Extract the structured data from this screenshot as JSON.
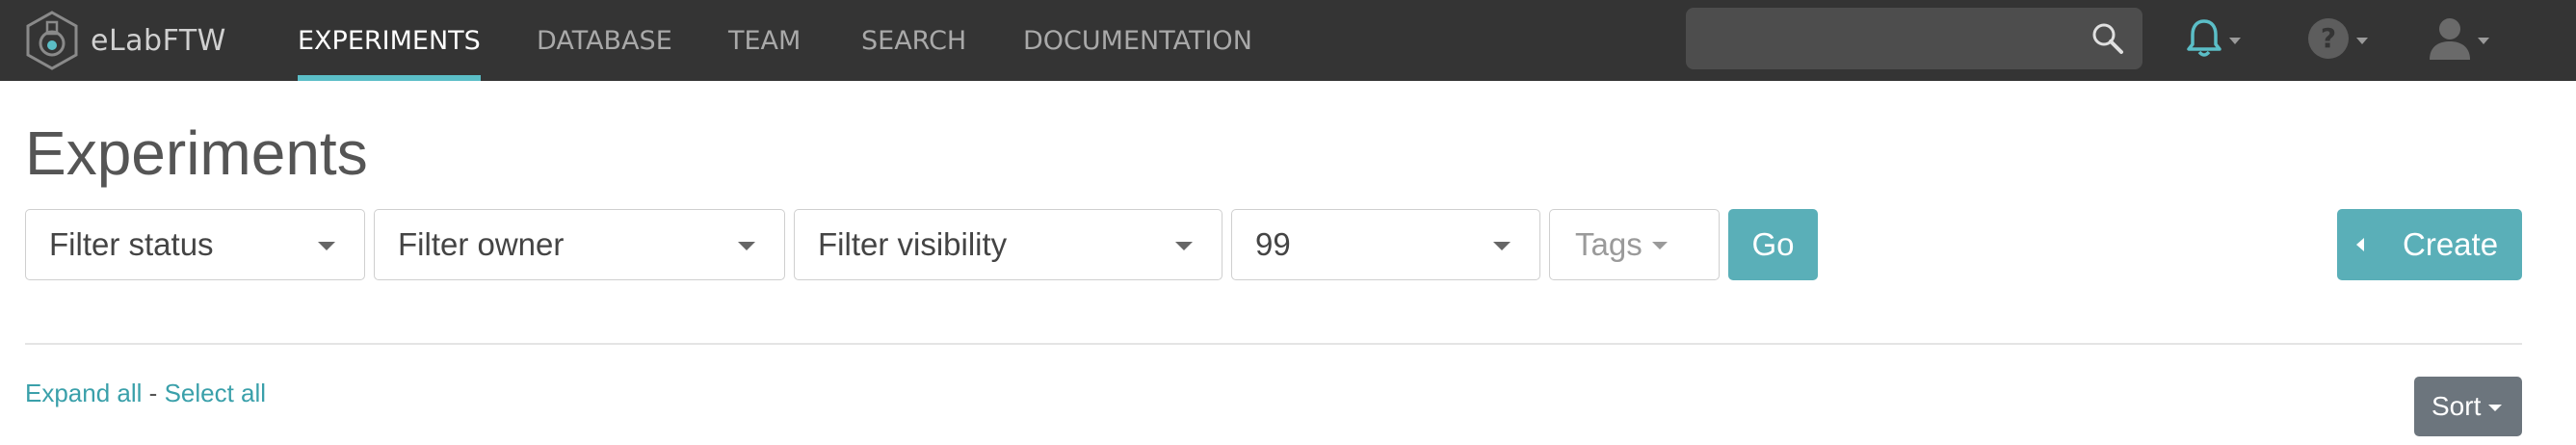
{
  "navbar": {
    "brand": "eLabFTW",
    "items": [
      {
        "label": "EXPERIMENTS",
        "active": true
      },
      {
        "label": "DATABASE",
        "active": false
      },
      {
        "label": "TEAM",
        "active": false
      },
      {
        "label": "SEARCH",
        "active": false
      },
      {
        "label": "DOCUMENTATION",
        "active": false
      }
    ],
    "search": {
      "placeholder": "",
      "value": ""
    },
    "icons": [
      "bell-icon",
      "help-icon",
      "user-icon"
    ],
    "accent": "#5bbec7"
  },
  "page": {
    "title": "Experiments"
  },
  "filters": {
    "status": "Filter status",
    "owner": "Filter owner",
    "visibility": "Filter visibility",
    "limit": "99",
    "tags": "Tags",
    "go": "Go"
  },
  "actions": {
    "create": "Create",
    "expand_all": "Expand all",
    "separator": "-",
    "select_all": "Select all",
    "sort": "Sort"
  },
  "colors": {
    "navbar_bg": "#343434",
    "primary_button": "#5aafb8",
    "secondary_button": "#6c757d",
    "link": "#3aa0aa"
  }
}
